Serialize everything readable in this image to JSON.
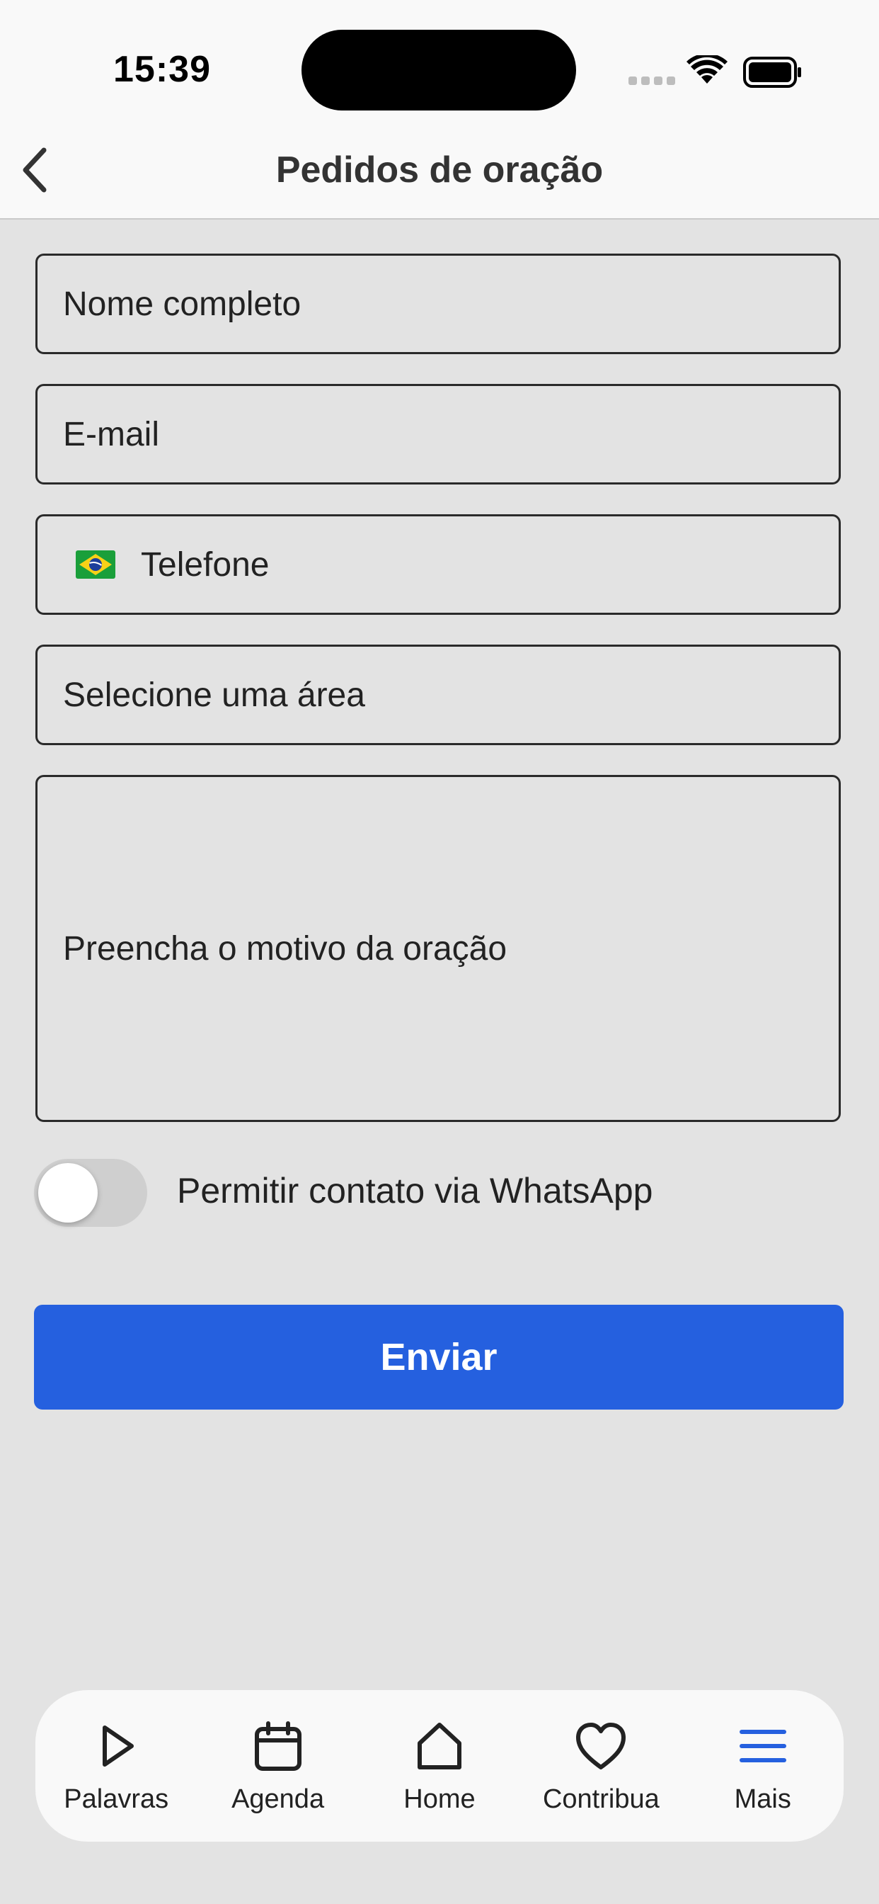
{
  "status_bar": {
    "time": "15:39"
  },
  "header": {
    "title": "Pedidos de oração"
  },
  "form": {
    "name_placeholder": "Nome completo",
    "email_placeholder": "E-mail",
    "phone_placeholder": "Telefone",
    "area_placeholder": "Selecione uma área",
    "reason_placeholder": "Preencha o motivo da oração",
    "whatsapp_label": "Permitir contato via WhatsApp",
    "whatsapp_enabled": false,
    "submit_label": "Enviar"
  },
  "colors": {
    "accent": "#2560df",
    "background": "#e3e3e3",
    "surface": "#f9f9f9"
  },
  "bottom_nav": {
    "items": [
      {
        "label": "Palavras",
        "icon": "play-icon"
      },
      {
        "label": "Agenda",
        "icon": "calendar-icon"
      },
      {
        "label": "Home",
        "icon": "home-icon"
      },
      {
        "label": "Contribua",
        "icon": "heart-icon"
      },
      {
        "label": "Mais",
        "icon": "menu-icon",
        "active": true
      }
    ]
  }
}
